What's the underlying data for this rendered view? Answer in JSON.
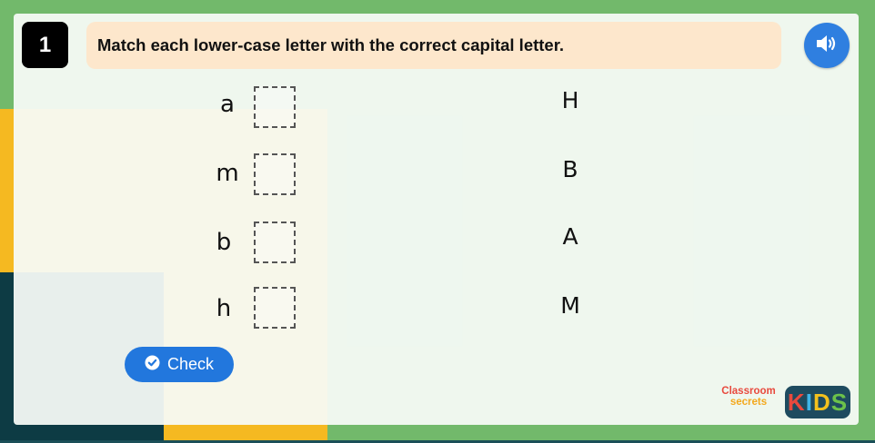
{
  "question": {
    "number": "1",
    "instruction": "Match each lower-case letter with the correct capital letter."
  },
  "audio": {
    "icon": "speaker-icon"
  },
  "lowercase_letters": [
    "a",
    "m",
    "b",
    "h"
  ],
  "capital_letters": [
    "H",
    "B",
    "A",
    "M"
  ],
  "check_button": {
    "label": "Check",
    "icon": "check-circle-icon"
  },
  "logo": {
    "classroom": "Classroom",
    "secrets": "secrets",
    "kids": [
      "K",
      "I",
      "D",
      "S"
    ],
    "kids_colors": [
      "#e8493d",
      "#3fb5e8",
      "#f3c11d",
      "#6cc24a"
    ]
  },
  "colors": {
    "background_green": "#72b96b",
    "instruction_bg": "#fde7cc",
    "accent_blue": "#2277dd",
    "block_yellow": "#f5b921",
    "block_teal": "#0d3b44"
  }
}
